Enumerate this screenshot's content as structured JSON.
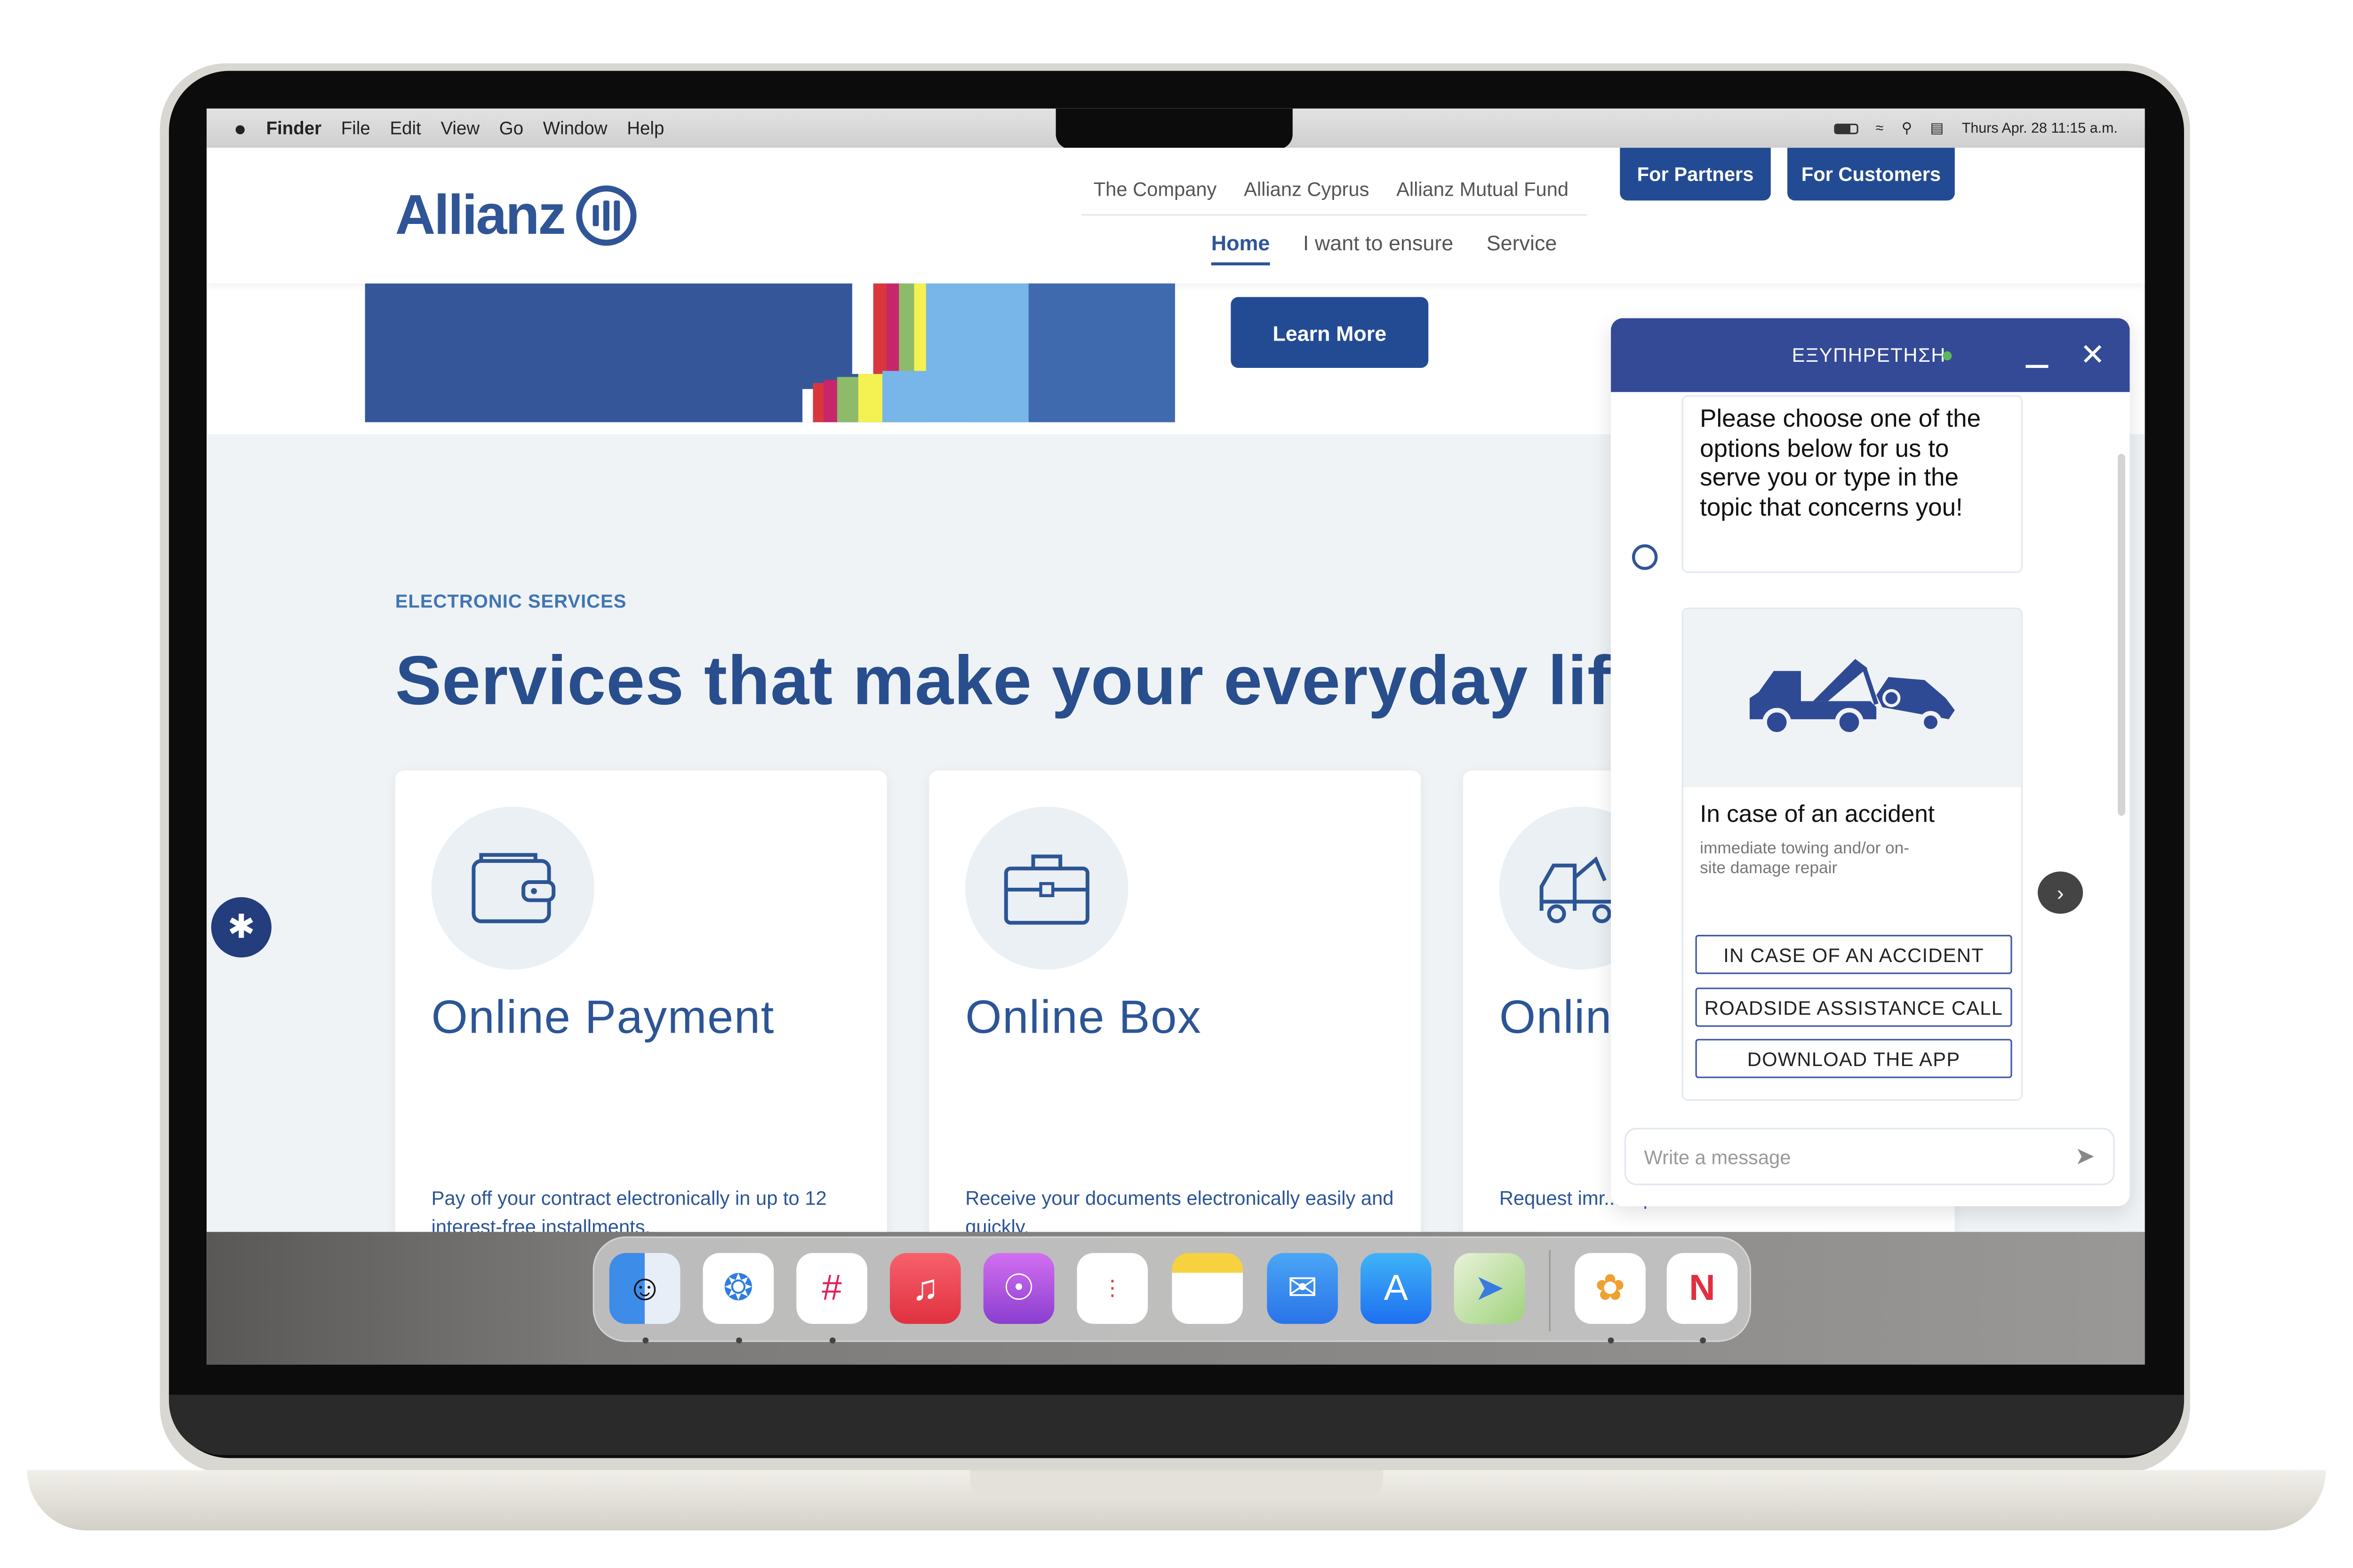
{
  "menubar": {
    "apple_icon": "apple-logo",
    "app": "Finder",
    "items": [
      "File",
      "Edit",
      "View",
      "Go",
      "Window",
      "Help"
    ],
    "datetime": "Thurs Apr. 28 11:15 a.m.",
    "status_icons": [
      "battery-icon",
      "wifi-icon",
      "search-icon",
      "control-center-icon"
    ]
  },
  "site": {
    "logo": "Allianz",
    "nav_top": [
      "The Company",
      "Allianz Cyprus",
      "Allianz Mutual Fund"
    ],
    "nav_main": [
      "Home",
      "I want to ensure",
      "Service"
    ],
    "nav_active": "Home",
    "buttons": {
      "partners": "For Partners",
      "customers": "For Customers",
      "learn_more": "Learn More"
    },
    "eyebrow": "ELECTRONIC SERVICES",
    "headline": "Services that make your everyday life",
    "cards": [
      {
        "icon": "wallet-icon",
        "title": "Online Payment",
        "desc": "Pay off your contract electronically in up to 12 interest-free installments."
      },
      {
        "icon": "briefcase-icon",
        "title": "Online Box",
        "desc": "Receive your documents electronically easily and quickly."
      },
      {
        "icon": "tow-truck-icon",
        "title": "Online",
        "desc": "Request imr... repair."
      }
    ]
  },
  "chat": {
    "title": "ΕΞΥΠΗΡΕΤΗΣΗ",
    "online_color": "#5cb85c",
    "message": "Please choose one of the options below for us to serve you or type in the topic that concerns you!",
    "card": {
      "title": "In case of an accident",
      "subtitle": "immediate towing and/or on-site damage repair",
      "options": [
        "IN CASE OF AN ACCIDENT",
        "ROADSIDE ASSISTANCE CALL",
        "DOWNLOAD THE APP"
      ]
    },
    "input_placeholder": "Write a message"
  },
  "dock": {
    "apps": [
      "Finder",
      "Safari",
      "Slack",
      "Music",
      "Podcasts",
      "Reminders",
      "Notes",
      "Mail",
      "App Store",
      "Maps",
      "Photos",
      "News"
    ]
  },
  "colors": {
    "brand": "#234b94",
    "chat_header": "#344a96",
    "text_blue": "#2c5596"
  }
}
